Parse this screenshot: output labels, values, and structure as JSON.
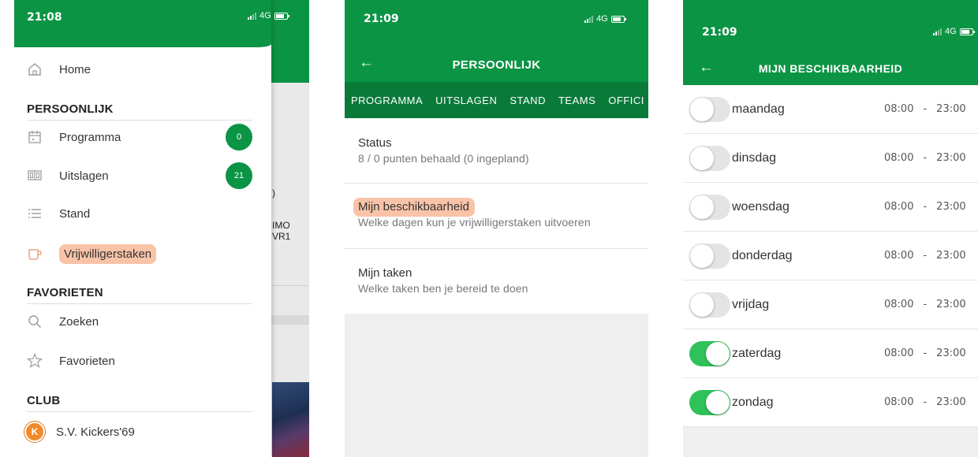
{
  "colors": {
    "primary_green": "#0b9444",
    "tab_bar_green": "#0a7a39",
    "toggle_on": "#2fc15a",
    "highlight": "#f9c3a8"
  },
  "screen1": {
    "status": {
      "time": "21:08",
      "network": "4G"
    },
    "background_fragments": {
      "line1": ")",
      "line2": "IMO",
      "line3": "VR1"
    },
    "menu": {
      "home": {
        "label": "Home",
        "icon": "home-icon"
      },
      "section_personal": "PERSOONLIJK",
      "programma": {
        "label": "Programma",
        "icon": "calendar-icon",
        "badge": "0"
      },
      "uitslagen": {
        "label": "Uitslagen",
        "icon": "scoreboard-icon",
        "badge": "21"
      },
      "stand": {
        "label": "Stand",
        "icon": "list-icon"
      },
      "vrijwilligerstaken": {
        "label": "Vrijwilligerstaken",
        "icon": "cup-icon"
      },
      "section_favorites": "FAVORIETEN",
      "zoeken": {
        "label": "Zoeken",
        "icon": "search-icon"
      },
      "favorieten": {
        "label": "Favorieten",
        "icon": "star-icon"
      },
      "section_club": "CLUB",
      "club": {
        "label": "S.V. Kickers'69",
        "icon": "club-logo-icon"
      }
    }
  },
  "screen2": {
    "status": {
      "time": "21:09",
      "network": "4G"
    },
    "header": {
      "title": "PERSOONLIJK",
      "back_icon": "back-arrow-icon"
    },
    "tabs": [
      "PROGRAMMA",
      "UITSLAGEN",
      "STAND",
      "TEAMS",
      "OFFICI"
    ],
    "rows": [
      {
        "title": "Status",
        "subtitle": "8 / 0 punten behaald (0 ingepland)"
      },
      {
        "title": "Mijn beschikbaarheid",
        "subtitle": "Welke dagen kun je vrijwilligerstaken uitvoeren"
      },
      {
        "title": "Mijn taken",
        "subtitle": "Welke taken ben je bereid te doen"
      }
    ]
  },
  "screen3": {
    "status": {
      "time": "21:09",
      "network": "4G"
    },
    "header": {
      "title": "MIJN BESCHIKBAARHEID",
      "back_icon": "back-arrow-icon"
    },
    "days": [
      {
        "label": "maandag",
        "from": "08:00",
        "sep": "-",
        "to": "23:00",
        "enabled": false
      },
      {
        "label": "dinsdag",
        "from": "08:00",
        "sep": "-",
        "to": "23:00",
        "enabled": false
      },
      {
        "label": "woensdag",
        "from": "08:00",
        "sep": "-",
        "to": "23:00",
        "enabled": false
      },
      {
        "label": "donderdag",
        "from": "08:00",
        "sep": "-",
        "to": "23:00",
        "enabled": false
      },
      {
        "label": "vrijdag",
        "from": "08:00",
        "sep": "-",
        "to": "23:00",
        "enabled": false
      },
      {
        "label": "zaterdag",
        "from": "08:00",
        "sep": "-",
        "to": "23:00",
        "enabled": true
      },
      {
        "label": "zondag",
        "from": "08:00",
        "sep": "-",
        "to": "23:00",
        "enabled": true
      }
    ]
  }
}
